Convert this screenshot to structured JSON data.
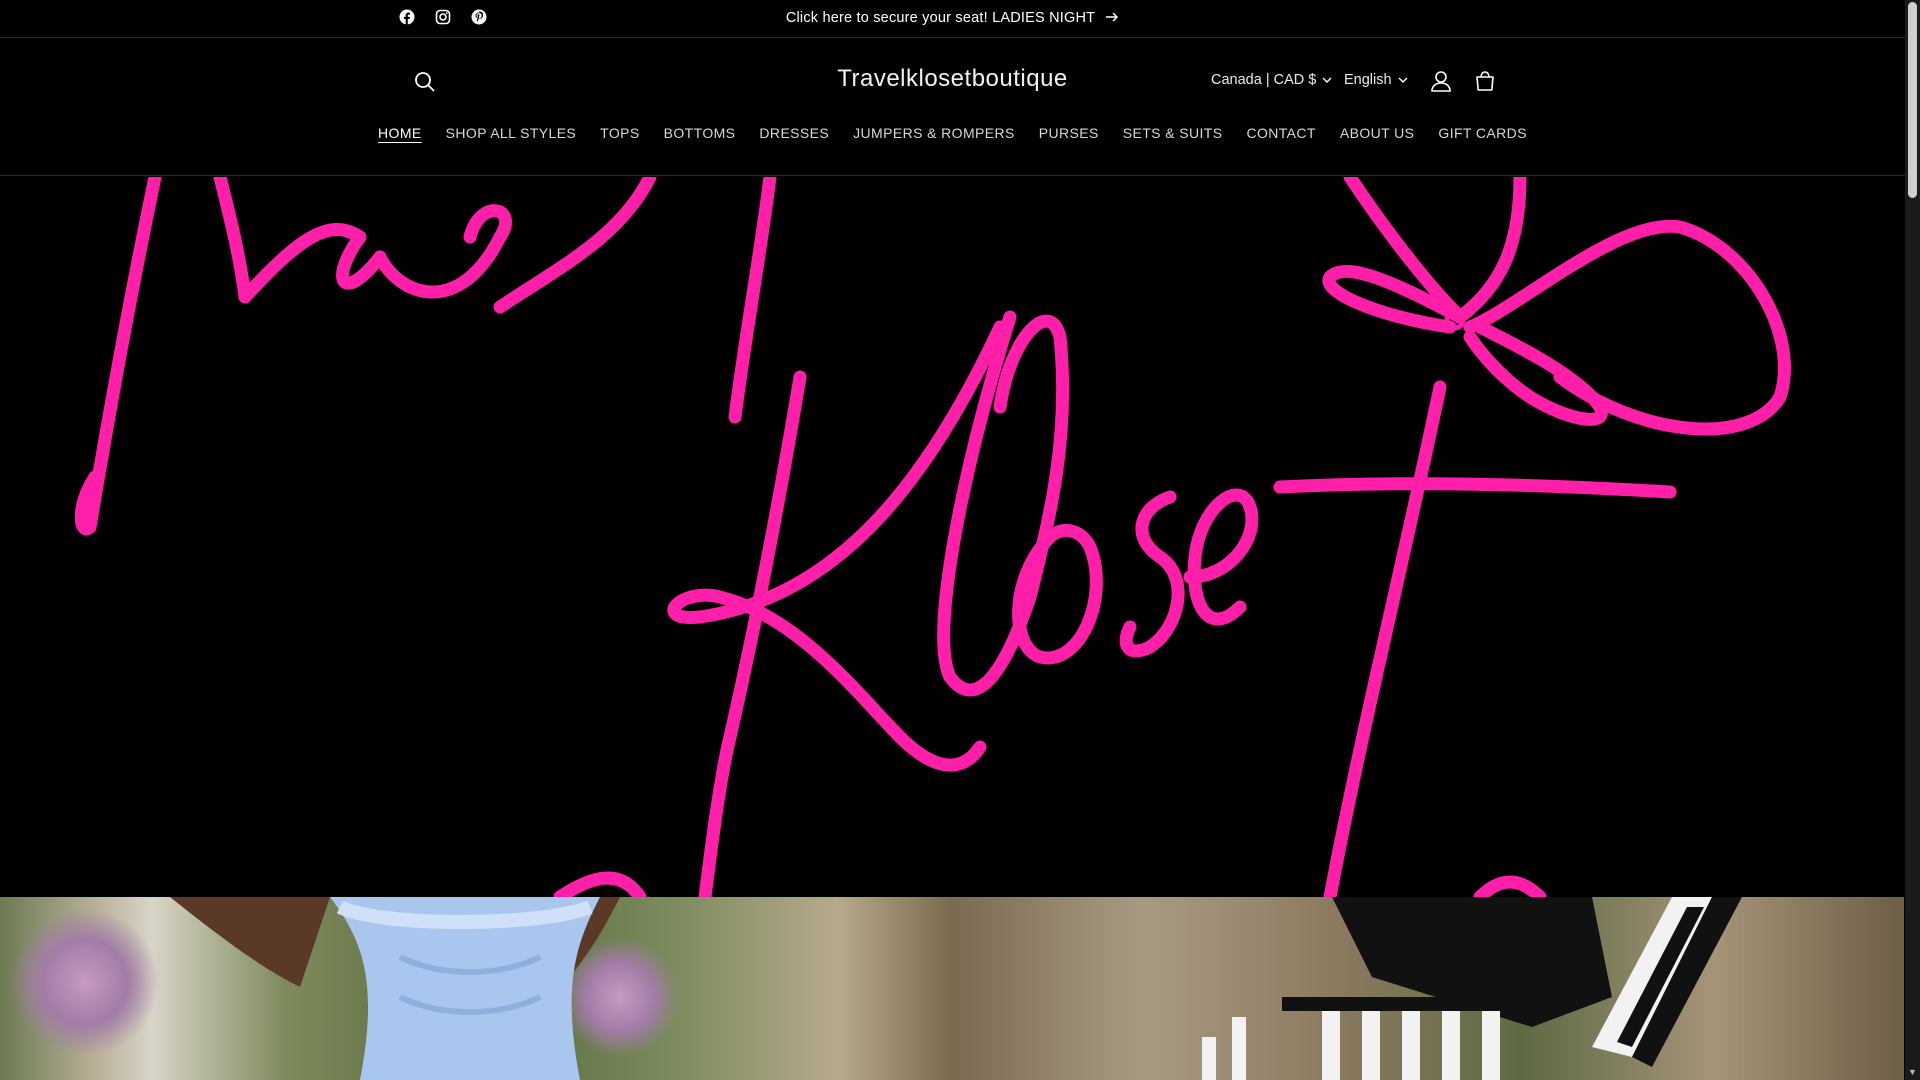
{
  "announcement": {
    "text": "Click here to secure your seat! LADIES NIGHT",
    "social": [
      "facebook-icon",
      "instagram-icon",
      "pinterest-icon"
    ]
  },
  "header": {
    "logo": "Travelklosetboutique",
    "country": "Canada | CAD $",
    "language": "English"
  },
  "nav": {
    "items": [
      "HOME",
      "SHOP ALL STYLES",
      "TOPS",
      "BOTTOMS",
      "DRESSES",
      "JUMPERS & ROMPERS",
      "PURSES",
      "SETS & SUITS",
      "CONTACT",
      "ABOUT US",
      "GIFT CARDS"
    ],
    "active": "HOME"
  },
  "hero": {
    "script_color": "#ff1fa8"
  },
  "colors": {
    "background": "#000000",
    "text": "#ffffff",
    "accent_pink": "#ff1fa8"
  }
}
